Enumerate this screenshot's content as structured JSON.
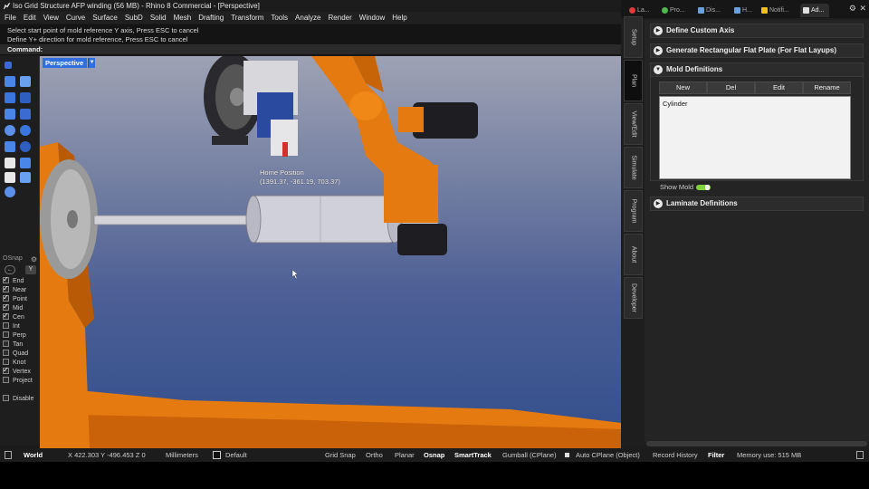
{
  "window": {
    "title": "Iso Grid Structure AFP winding (56 MB) - Rhino 8 Commercial - [Perspective]"
  },
  "menu": [
    "File",
    "Edit",
    "View",
    "Curve",
    "Surface",
    "SubD",
    "Solid",
    "Mesh",
    "Drafting",
    "Transform",
    "Tools",
    "Analyze",
    "Render",
    "Window",
    "Help"
  ],
  "command": {
    "history": [
      "Select start point of mold reference Y axis, Press ESC to cancel",
      "Define Y+ direction for mold reference, Press ESC to cancel"
    ],
    "prompt": "Command:"
  },
  "osnap": {
    "title": "OSnap",
    "items": [
      {
        "label": "End",
        "checked": true
      },
      {
        "label": "Near",
        "checked": true
      },
      {
        "label": "Point",
        "checked": true
      },
      {
        "label": "Mid",
        "checked": true
      },
      {
        "label": "Cen",
        "checked": true
      },
      {
        "label": "Int",
        "checked": false
      },
      {
        "label": "Perp",
        "checked": false
      },
      {
        "label": "Tan",
        "checked": false
      },
      {
        "label": "Quad",
        "checked": false
      },
      {
        "label": "Knot",
        "checked": false
      },
      {
        "label": "Vertex",
        "checked": true
      },
      {
        "label": "Project",
        "checked": false
      }
    ],
    "disable": "Disable"
  },
  "viewport": {
    "name": "Perspective",
    "annotation_title": "Home Position",
    "annotation_coords": "(1391.37, -361.19, 703.37)"
  },
  "panel_tabs": [
    {
      "label": "La...",
      "color": "#e03a3a"
    },
    {
      "label": "Pro...",
      "color": "#4fb84f"
    },
    {
      "label": "Dis...",
      "color": "#6aa0e0"
    },
    {
      "label": "H...",
      "color": "#6aa0e0"
    },
    {
      "label": "Notifi...",
      "color": "#f0c020"
    },
    {
      "label": "Ad...",
      "color": "#e0e0e0"
    }
  ],
  "side_tabs": [
    "Setup",
    "Plan",
    "View/Edit",
    "Simulate",
    "Program",
    "About",
    "Developer"
  ],
  "active_side_tab": "Plan",
  "sections": {
    "custom_axis": "Define Custom Axis",
    "flat_plate": "Generate Rectangular Flat Plate (For Flat Layups)",
    "mold_defs": "Mold Definitions",
    "laminate_defs": "Laminate Definitions"
  },
  "mold_buttons": {
    "new": "New",
    "del": "Del",
    "edit": "Edit",
    "rename": "Rename"
  },
  "mold_list": [
    "Cylinder"
  ],
  "show_mold": "Show Mold",
  "statusbar": {
    "cplane": "World",
    "coords": "X 422.303  Y -496.453  Z 0",
    "units": "Millimeters",
    "layer": "Default",
    "grid_snap": "Grid Snap",
    "ortho": "Ortho",
    "planar": "Planar",
    "osnap": "Osnap",
    "smarttrack": "SmartTrack",
    "gumball": "Gumball (CPlane)",
    "auto_cplane": "Auto CPlane (Object)",
    "record_history": "Record History",
    "filter": "Filter",
    "memory": "Memory use: 515 MB"
  },
  "colors": {
    "accent_blue": "#2f6fe0",
    "robot_orange": "#e57a10",
    "toggle_green": "#7fd23a"
  }
}
